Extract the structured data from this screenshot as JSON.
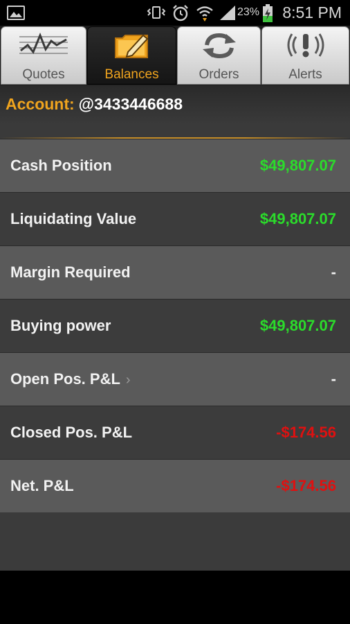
{
  "status_bar": {
    "battery_percent": "23%",
    "time": "8:51 PM",
    "icons": [
      "gallery-notification-icon",
      "vibrate-icon",
      "alarm-icon",
      "wifi-icon",
      "signal-icon",
      "battery-charging-icon"
    ]
  },
  "tabs": [
    {
      "label": "Quotes",
      "icon": "chart-icon",
      "active": false
    },
    {
      "label": "Balances",
      "icon": "notepad-pencil-icon",
      "active": true
    },
    {
      "label": "Orders",
      "icon": "refresh-arrows-icon",
      "active": false
    },
    {
      "label": "Alerts",
      "icon": "alert-icon",
      "active": false
    }
  ],
  "account": {
    "label": "Account:",
    "number": "@3433446688"
  },
  "balances": [
    {
      "label": "Cash Position",
      "value": "$49,807.07",
      "status": "positive"
    },
    {
      "label": "Liquidating Value",
      "value": "$49,807.07",
      "status": "positive"
    },
    {
      "label": "Margin Required",
      "value": "-",
      "status": "neutral"
    },
    {
      "label": "Buying power",
      "value": "$49,807.07",
      "status": "positive"
    },
    {
      "label": "Open Pos. P&L",
      "value": "-",
      "status": "neutral",
      "has_chevron": true,
      "chevron": "›"
    },
    {
      "label": "Closed Pos. P&L",
      "value": "-$174.56",
      "status": "negative"
    },
    {
      "label": "Net. P&L",
      "value": "-$174.56",
      "status": "negative"
    }
  ],
  "colors": {
    "accent": "#f0a41e",
    "positive": "#2bdc2b",
    "negative": "#e01010"
  }
}
